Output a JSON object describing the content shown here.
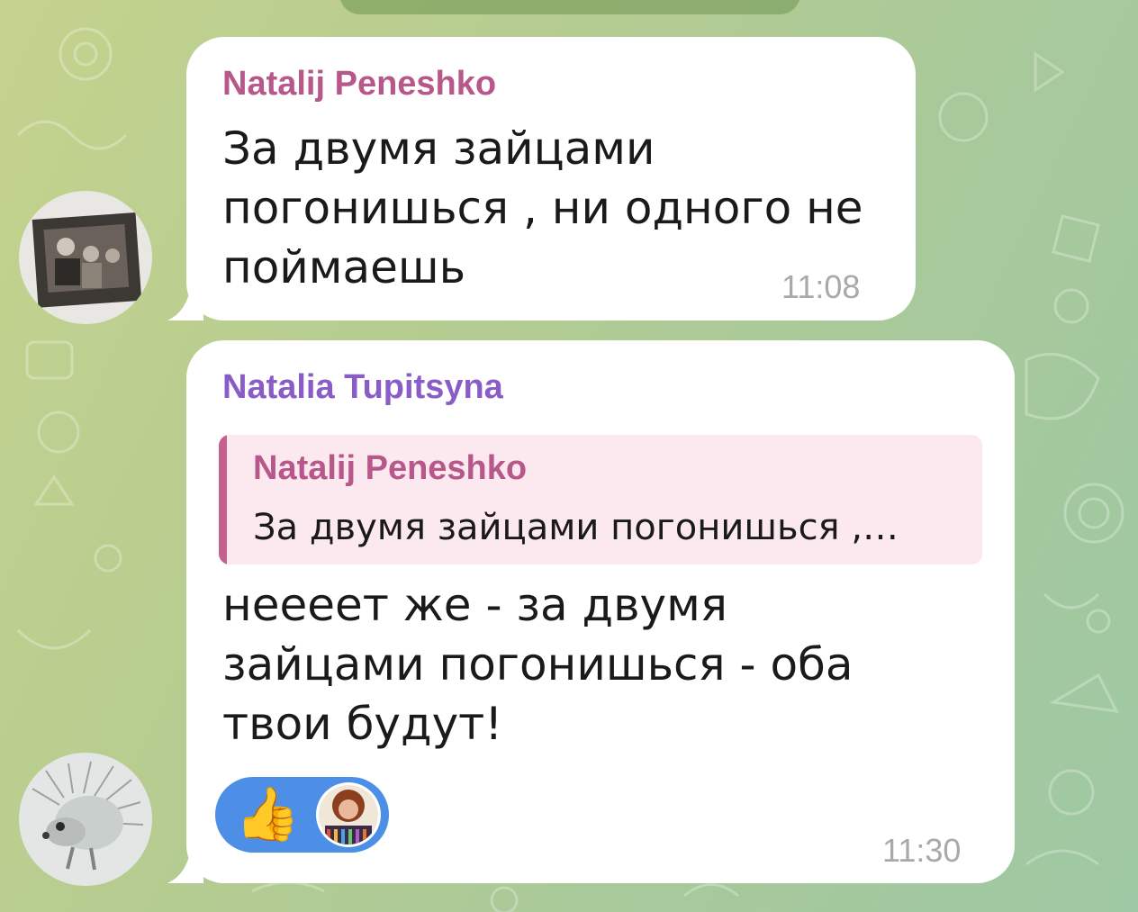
{
  "date_label": "",
  "messages": [
    {
      "sender": "Natalij Peneshko",
      "sender_color": "#b8578a",
      "lines": [
        "За двумя зайцами",
        "погонишься , ни одного не",
        "поймаешь"
      ],
      "time": "11:08",
      "avatar": "photo-avatar"
    },
    {
      "sender": "Natalia Tupitsyna",
      "sender_color": "#8a5cc7",
      "reply": {
        "sender": "Natalij Peneshko",
        "text": "За двумя зайцами погонишься ,…"
      },
      "lines": [
        "неееет же - за двумя",
        "зайцами погонишься - оба",
        "твои будут!"
      ],
      "reaction": {
        "emoji": "👍",
        "icon": "thumbs-up-icon"
      },
      "time": "11:30",
      "avatar": "hedgehog-avatar"
    }
  ],
  "colors": {
    "bubble": "#ffffff",
    "reply_background": "#fbe9ef",
    "reply_bar": "#c4618f",
    "reaction_background": "#4d8fe6",
    "time": "#a7a9ab"
  }
}
